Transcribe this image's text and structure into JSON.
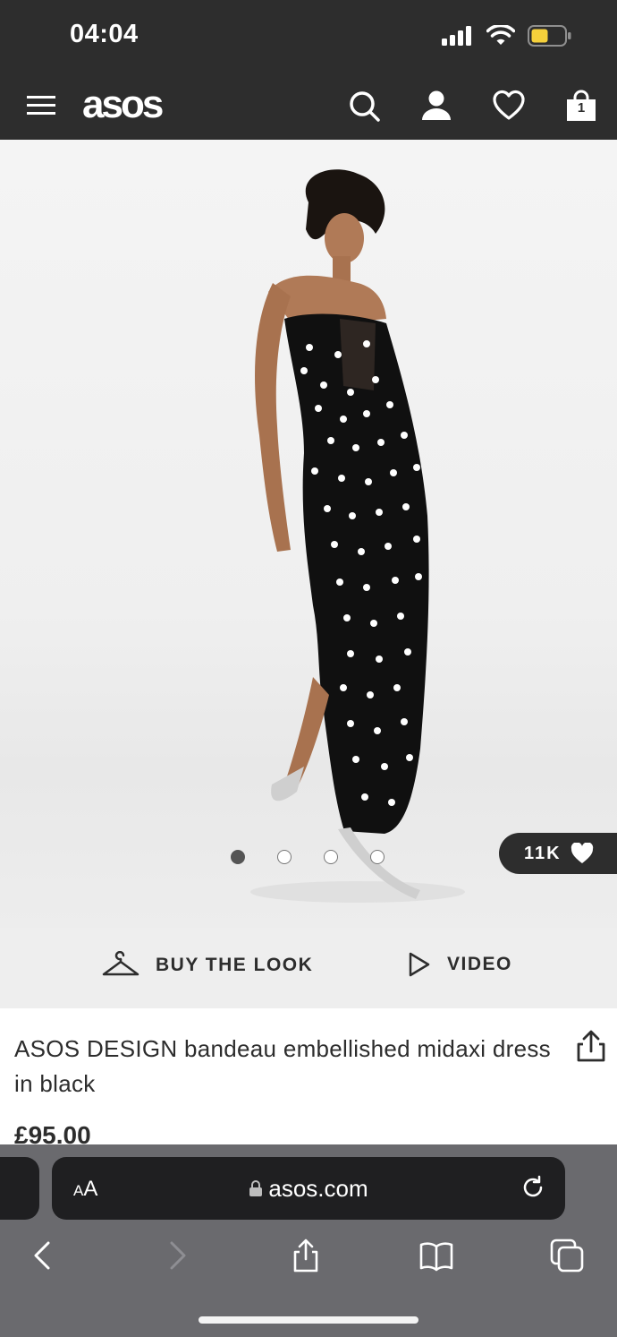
{
  "status_bar": {
    "time": "04:04",
    "battery_color": "#f5d03b"
  },
  "nav": {
    "logo": "asos",
    "icons": [
      "menu-icon",
      "search-icon",
      "account-icon",
      "heart-icon",
      "bag-icon"
    ],
    "bag_count": "1"
  },
  "gallery": {
    "image": "product-photo-black-embellished-dress",
    "dots_total": 4,
    "active_dot": 1,
    "likes": "11K"
  },
  "actions": {
    "buy_the_look": "BUY THE LOOK",
    "video": "VIDEO"
  },
  "product": {
    "title": "ASOS DESIGN bandeau embellished midaxi dress in black",
    "price": "£95.00"
  },
  "browser": {
    "text_size_label_small": "A",
    "text_size_label_large": "A",
    "url": "asos.com"
  }
}
